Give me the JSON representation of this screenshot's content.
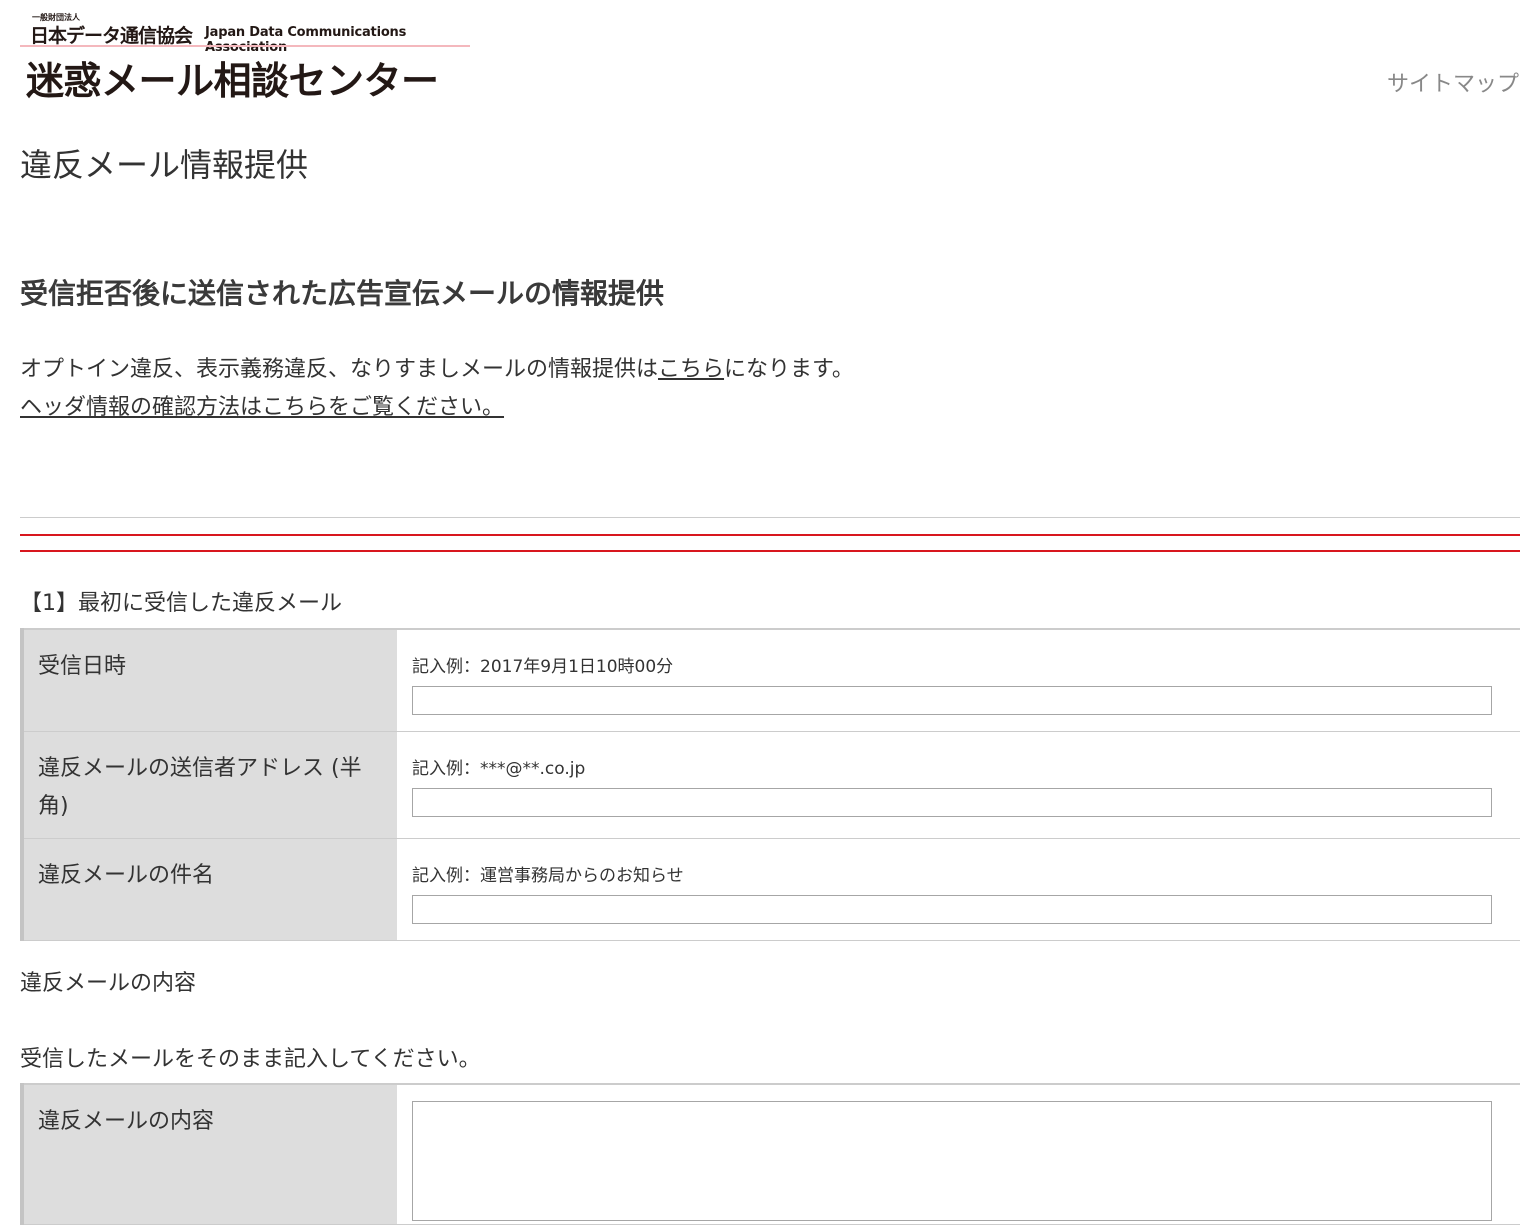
{
  "header": {
    "logo": {
      "small_text": "一般財団法人",
      "org_ja": "日本データ通信協会",
      "org_en": "Japan Data Communications Association",
      "main": "迷惑メール相談センター"
    },
    "sitemap_label": "サイトマップ"
  },
  "page_title": "違反メール情報提供",
  "section_title": "受信拒否後に送信された広告宣伝メールの情報提供",
  "intro": {
    "line1_before": "オプトイン違反、表示義務違反、なりすましメールの情報提供は",
    "line1_link": "こちら",
    "line1_after": "になります。",
    "line2_link": "ヘッダ情報の確認方法はこちらをご覧ください。"
  },
  "section1": {
    "heading": "【1】最初に受信した違反メール",
    "rows": [
      {
        "label": "受信日時",
        "hint": "記入例：2017年9月1日10時00分",
        "value": ""
      },
      {
        "label": "違反メールの送信者アドレス (半角)",
        "hint": "記入例：***@**.co.jp",
        "value": ""
      },
      {
        "label": "違反メールの件名",
        "hint": "記入例：運営事務局からのお知らせ",
        "value": ""
      }
    ],
    "content_heading": "違反メールの内容",
    "content_instruction": "受信したメールをそのまま記入してください。",
    "content_label": "違反メールの内容",
    "content_value": ""
  },
  "colors": {
    "accent_red": "#d8161e",
    "label_bg": "#dddddd",
    "logo_rule": "#f4b8bd",
    "text": "#333333"
  }
}
